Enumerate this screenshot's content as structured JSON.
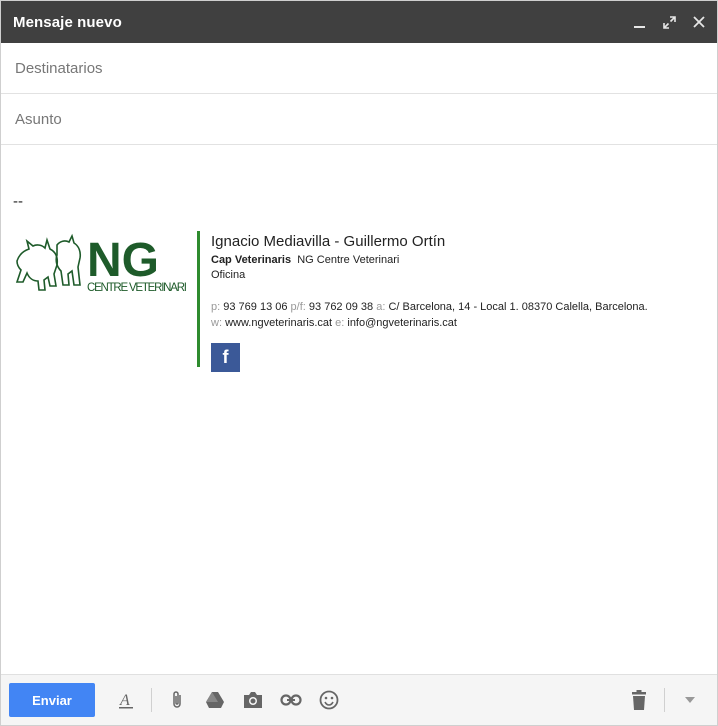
{
  "window": {
    "title": "Mensaje nuevo"
  },
  "fields": {
    "recipients_placeholder": "Destinatarios",
    "subject_placeholder": "Asunto"
  },
  "signature": {
    "dash": "--",
    "logo": {
      "big": "NG",
      "sub": "CENTRE VETERINARI"
    },
    "name": "Ignacio Mediavilla - Guillermo Ortín",
    "title_bold": "Cap Veterinaris",
    "company": "NG Centre Veterinari",
    "office": "Oficina",
    "p_label": "p:",
    "phone": "93 769 13 06",
    "pf_label": "p/f:",
    "phone_fax": "93 762 09 38",
    "a_label": "a:",
    "address": "C/ Barcelona, 14 - Local 1. 08370 Calella, Barcelona.",
    "w_label": "w:",
    "website": "www.ngveterinaris.cat",
    "e_label": "e:",
    "email": "info@ngveterinaris.cat",
    "facebook": "f"
  },
  "toolbar": {
    "send_label": "Enviar"
  },
  "colors": {
    "titlebar": "#404040",
    "send": "#4285f4",
    "divider": "#2e8b2e",
    "facebook": "#3b5998",
    "logo_green": "#1e5b2a"
  }
}
